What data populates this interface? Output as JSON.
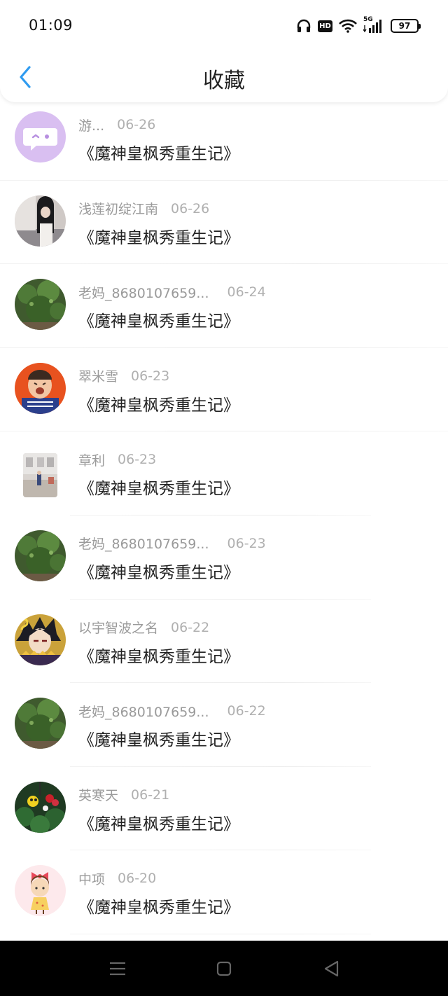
{
  "status_bar": {
    "time": "01:09",
    "icons": [
      "headphones-icon",
      "hd-icon",
      "wifi-icon",
      "5g-signal-icon",
      "battery-icon"
    ],
    "hd_label": "HD",
    "network_label": "5G",
    "battery_level": "97"
  },
  "header": {
    "title": "收藏",
    "back_icon": "chevron-left-icon",
    "accent_color": "#2f9bf0"
  },
  "favorites": [
    {
      "user": "游...",
      "date": "06-26",
      "book": "《魔神皇枫秀重生记》",
      "avatar": "chat-bubble-avatar"
    },
    {
      "user": "浅莲初绽江南",
      "date": "06-26",
      "book": "《魔神皇枫秀重生记》",
      "avatar": "girl-photo-avatar"
    },
    {
      "user": "老妈_8680107659...",
      "date": "06-24",
      "book": "《魔神皇枫秀重生记》",
      "avatar": "bush-photo-avatar"
    },
    {
      "user": "翠米雪",
      "date": "06-23",
      "book": "《魔神皇枫秀重生记》",
      "avatar": "baby-photo-avatar"
    },
    {
      "user": "章利",
      "date": "06-23",
      "book": "《魔神皇枫秀重生记》",
      "avatar": "street-photo-avatar"
    },
    {
      "user": "老妈_8680107659...",
      "date": "06-23",
      "book": "《魔神皇枫秀重生记》",
      "avatar": "bush-photo-avatar"
    },
    {
      "user": "以宇智波之名",
      "date": "06-22",
      "book": "《魔神皇枫秀重生记》",
      "avatar": "anime-character-avatar"
    },
    {
      "user": "老妈_8680107659...",
      "date": "06-22",
      "book": "《魔神皇枫秀重生记》",
      "avatar": "bush-photo-avatar"
    },
    {
      "user": "英寒天",
      "date": "06-21",
      "book": "《魔神皇枫秀重生记》",
      "avatar": "flowers-photo-avatar"
    },
    {
      "user": "中项",
      "date": "06-20",
      "book": "《魔神皇枫秀重生记》",
      "avatar": "cartoon-girl-avatar"
    }
  ],
  "system_nav": {
    "buttons": [
      "menu-icon",
      "home-icon",
      "back-triangle-icon"
    ]
  }
}
